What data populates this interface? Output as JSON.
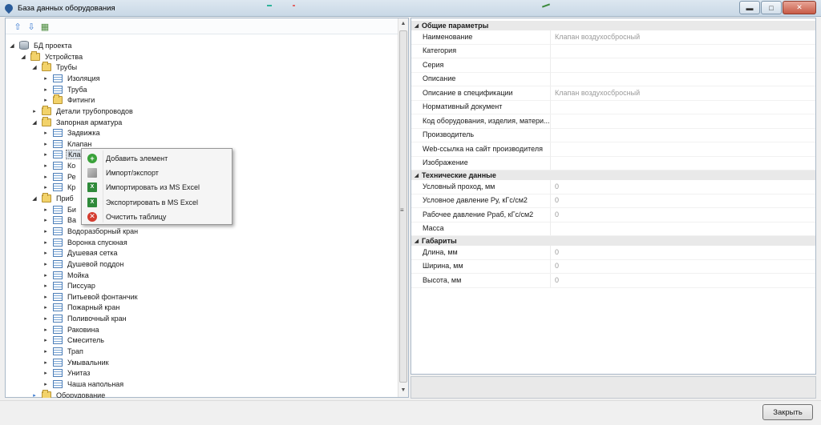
{
  "window": {
    "title": "База данных оборудования"
  },
  "tree": {
    "items": [
      {
        "label": "БД проекта",
        "icon": "database-icon"
      },
      {
        "label": "Устройства",
        "icon": "folder-icon"
      },
      {
        "label": "Трубы",
        "icon": "folder-icon"
      },
      {
        "label": "Изоляция",
        "icon": "table-icon"
      },
      {
        "label": "Труба",
        "icon": "table-icon"
      },
      {
        "label": "Фитинги",
        "icon": "folder-icon"
      },
      {
        "label": "Детали трубопроводов",
        "icon": "folder-icon"
      },
      {
        "label": "Запорная арматура",
        "icon": "folder-icon"
      },
      {
        "label": "Задвижка",
        "icon": "table-icon"
      },
      {
        "label": "Клапан",
        "icon": "table-icon"
      },
      {
        "label": "Кла",
        "icon": "table-icon"
      },
      {
        "label": "Ко",
        "icon": "table-icon"
      },
      {
        "label": "Ре",
        "icon": "table-icon"
      },
      {
        "label": "Кр",
        "icon": "table-icon"
      },
      {
        "label": "Приб",
        "icon": "folder-icon"
      },
      {
        "label": "Би",
        "icon": "table-icon"
      },
      {
        "label": "Ва",
        "icon": "table-icon"
      },
      {
        "label": "Водоразборный кран",
        "icon": "table-icon"
      },
      {
        "label": "Воронка спускная",
        "icon": "table-icon"
      },
      {
        "label": "Душевая сетка",
        "icon": "table-icon"
      },
      {
        "label": "Душевой поддон",
        "icon": "table-icon"
      },
      {
        "label": "Мойка",
        "icon": "table-icon"
      },
      {
        "label": "Писсуар",
        "icon": "table-icon"
      },
      {
        "label": "Питьевой фонтанчик",
        "icon": "table-icon"
      },
      {
        "label": "Пожарный кран",
        "icon": "table-icon"
      },
      {
        "label": "Поливочный кран",
        "icon": "table-icon"
      },
      {
        "label": "Раковина",
        "icon": "table-icon"
      },
      {
        "label": "Смеситель",
        "icon": "table-icon"
      },
      {
        "label": "Трап",
        "icon": "table-icon"
      },
      {
        "label": "Умывальник",
        "icon": "table-icon"
      },
      {
        "label": "Унитаз",
        "icon": "table-icon"
      },
      {
        "label": "Чаша напольная",
        "icon": "table-icon"
      },
      {
        "label": "Оборудование",
        "icon": "folder-icon"
      }
    ]
  },
  "context_menu": {
    "items": [
      {
        "label": "Добавить элемент",
        "icon": "add-icon"
      },
      {
        "label": "Импорт/экспорт",
        "icon": "import-export-icon"
      },
      {
        "label": "Импортировать из MS Excel",
        "icon": "excel-import-icon"
      },
      {
        "label": "Экспортировать в MS Excel",
        "icon": "excel-export-icon"
      },
      {
        "label": "Очистить таблицу",
        "icon": "clear-icon"
      }
    ]
  },
  "properties": {
    "general": {
      "header": "Общие параметры",
      "rows": [
        {
          "name": "Наименование",
          "value": "Клапан воздухосбросный"
        },
        {
          "name": "Категория",
          "value": ""
        },
        {
          "name": "Серия",
          "value": ""
        },
        {
          "name": "Описание",
          "value": ""
        },
        {
          "name": "Описание в спецификации",
          "value": "Клапан воздухосбросный"
        },
        {
          "name": "Нормативный документ",
          "value": ""
        },
        {
          "name": "Код оборудования, изделия, матери...",
          "value": ""
        },
        {
          "name": "Производитель",
          "value": ""
        },
        {
          "name": "Web-ссылка на сайт производителя",
          "value": ""
        },
        {
          "name": "Изображение",
          "value": ""
        }
      ]
    },
    "technical": {
      "header": "Технические данные",
      "rows": [
        {
          "name": "Условный проход, мм",
          "value": "0"
        },
        {
          "name": "Условное давление Ру, кГс/см2",
          "value": "0"
        },
        {
          "name": "Рабочее давление Рраб, кГс/см2",
          "value": "0"
        },
        {
          "name": "Масса",
          "value": ""
        }
      ]
    },
    "dimensions": {
      "header": "Габариты",
      "rows": [
        {
          "name": "Длина, мм",
          "value": "0"
        },
        {
          "name": "Ширина, мм",
          "value": "0"
        },
        {
          "name": "Высота, мм",
          "value": "0"
        }
      ]
    }
  },
  "footer": {
    "close_label": "Закрыть"
  }
}
